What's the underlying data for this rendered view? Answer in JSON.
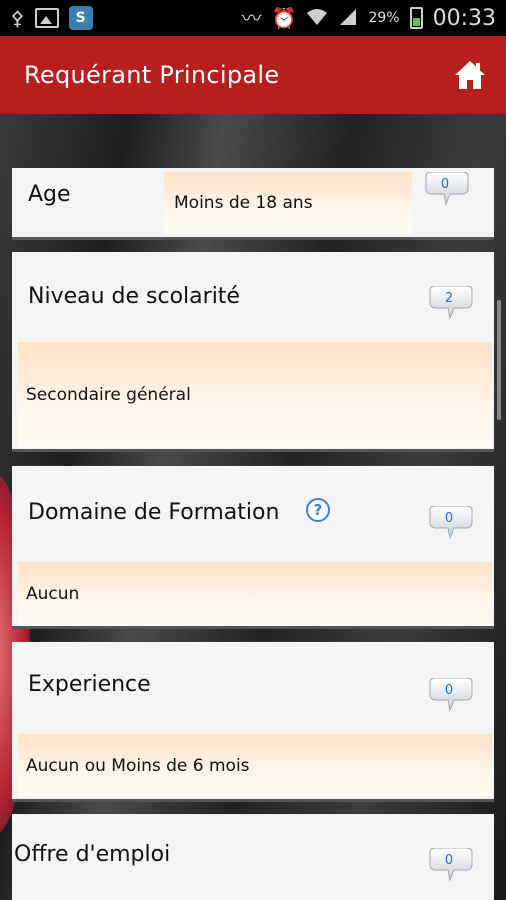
{
  "status_bar": {
    "battery": "29%",
    "time": "00:33",
    "icons": [
      "usb-icon",
      "image-icon",
      "skype-icon",
      "vibrate-icon",
      "alarm-icon",
      "wifi-icon",
      "signal-icon",
      "battery-charging-icon"
    ]
  },
  "action_bar": {
    "title": "Requérant Principale",
    "home_icon": "home-icon"
  },
  "items": [
    {
      "label": "Age",
      "value": "Moins de 18 ans",
      "count": "0"
    },
    {
      "label": "Niveau de scolarité",
      "value": "Secondaire général",
      "count": "2"
    },
    {
      "label": "Domaine de Formation",
      "value": "Aucun",
      "count": "0",
      "help": "?"
    },
    {
      "label": "Experience",
      "value": "Aucun ou Moins de 6 mois",
      "count": "0"
    },
    {
      "label": "Offre d'emploi",
      "count": "0"
    }
  ],
  "colors": {
    "action_bar": "#b81e1e",
    "value_bg": "#ffe2c4",
    "bubble_text": "#2a6ab8"
  }
}
